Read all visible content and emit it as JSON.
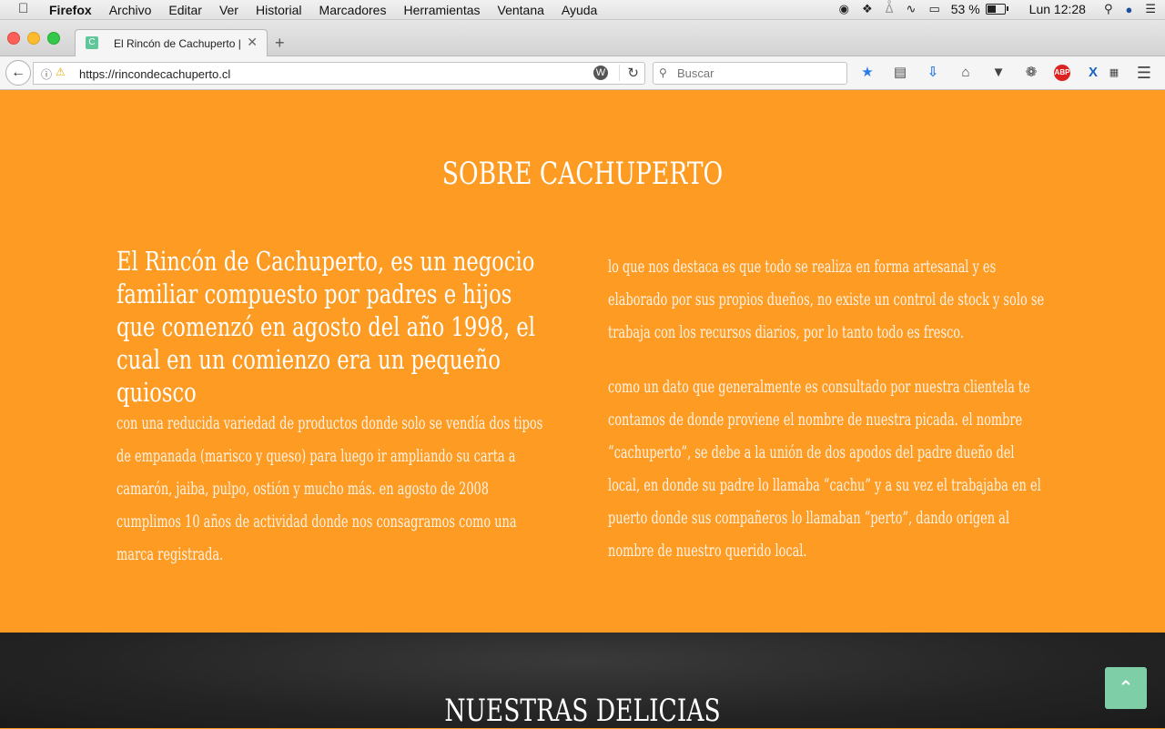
{
  "menubar": {
    "apple_icon": "apple-icon",
    "items": [
      "Firefox",
      "Archivo",
      "Editar",
      "Ver",
      "Historial",
      "Marcadores",
      "Herramientas",
      "Ventana",
      "Ayuda"
    ],
    "battery_percent": "53 %",
    "battery_level": 0.53,
    "clock": "Lun 12:28"
  },
  "tab": {
    "title": "El Rincón de Cachuperto |",
    "favicon_letter": "C"
  },
  "navbar": {
    "url": "https://rincondecachuperto.cl",
    "search_placeholder": "Buscar"
  },
  "page": {
    "section_title": "Sobre Cachuperto",
    "left_lead": "El Rincón de Cachuperto, es un negocio familiar compuesto por padres e hijos que comenzó en agosto del año 1998, el cual en un comienzo era un pequeño quiosco",
    "left_body": "con una reducida variedad de productos donde solo se vendía dos tipos de empanada (marisco y queso) para luego ir ampliando su carta a camarón, jaiba, pulpo, ostión y mucho más. En agosto de 2008 cumplimos 10 años de actividad donde nos consagramos como una marca registrada.",
    "right_p1": "Lo que nos destaca es que todo se realiza en forma artesanal y es elaborado por sus propios dueños, no existe un control de stock y solo se trabaja con los recursos diarios, por lo tanto todo es fresco.",
    "right_p2": "Como un dato que generalmente es consultado por nuestra clientela te contamos de donde proviene el nombre de nuestra picada. El nombre “Cachuperto”, se debe a la unión de dos apodos del padre dueño del local, en donde su padre lo llamaba “Cachu” y a su vez el trabajaba en el puerto donde sus compañeros lo llamaban “Perto”, dando origen al nombre de nuestro querido local.",
    "next_section_title": "Nuestras delicias"
  },
  "colors": {
    "section_bg": "#fd9b23",
    "dark_bg": "#242424",
    "to_top_button": "#7ecfa7"
  }
}
